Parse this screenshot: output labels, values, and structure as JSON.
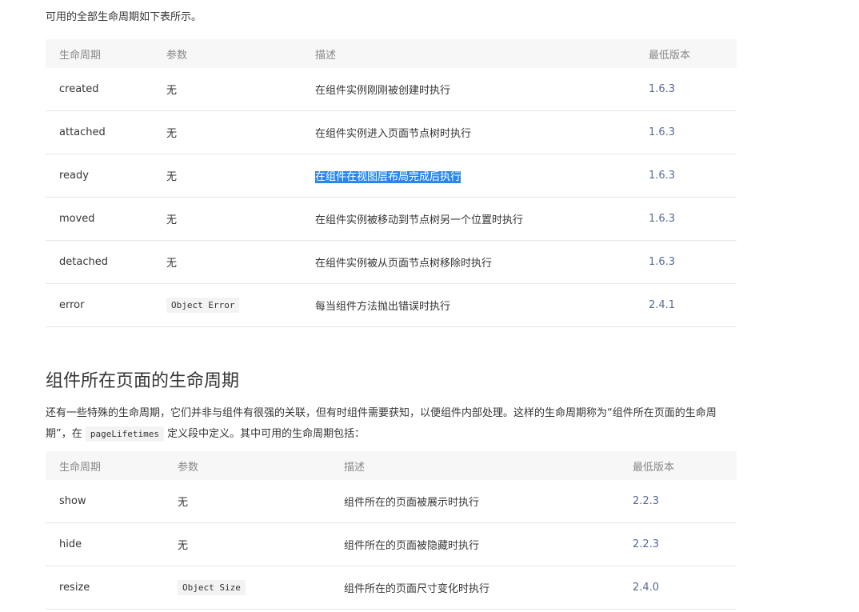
{
  "intro": "可用的全部生命周期如下表所示。",
  "table1": {
    "headers": [
      "生命周期",
      "参数",
      "描述",
      "最低版本"
    ],
    "rows": [
      {
        "name": "created",
        "param": "无",
        "desc": "在组件实例刚刚被创建时执行",
        "version": "1.6.3"
      },
      {
        "name": "attached",
        "param": "无",
        "desc": "在组件实例进入页面节点树时执行",
        "version": "1.6.3"
      },
      {
        "name": "ready",
        "param": "无",
        "desc": "在组件在视图层布局完成后执行",
        "version": "1.6.3"
      },
      {
        "name": "moved",
        "param": "无",
        "desc": "在组件实例被移动到节点树另一个位置时执行",
        "version": "1.6.3"
      },
      {
        "name": "detached",
        "param": "无",
        "desc": "在组件实例被从页面节点树移除时执行",
        "version": "1.6.3"
      },
      {
        "name": "error",
        "param": "Object Error",
        "desc": "每当组件方法抛出错误时执行",
        "version": "2.4.1"
      }
    ]
  },
  "section2": {
    "title": "组件所在页面的生命周期",
    "para_part1": "还有一些特殊的生命周期，它们并非与组件有很强的关联，但有时组件需要获知，以便组件内部处理。这样的生命周期称为“组件所在页面的生命周期”，在",
    "para_code": "pageLifetimes",
    "para_part2": "定义段中定义。其中可用的生命周期包括："
  },
  "table2": {
    "headers": [
      "生命周期",
      "参数",
      "描述",
      "最低版本"
    ],
    "rows": [
      {
        "name": "show",
        "param": "无",
        "desc": "组件所在的页面被展示时执行",
        "version": "2.2.3"
      },
      {
        "name": "hide",
        "param": "无",
        "desc": "组件所在的页面被隐藏时执行",
        "version": "2.2.3"
      },
      {
        "name": "resize",
        "param": "Object Size",
        "desc": "组件所在的页面尺寸变化时执行",
        "version": "2.4.0"
      }
    ]
  }
}
